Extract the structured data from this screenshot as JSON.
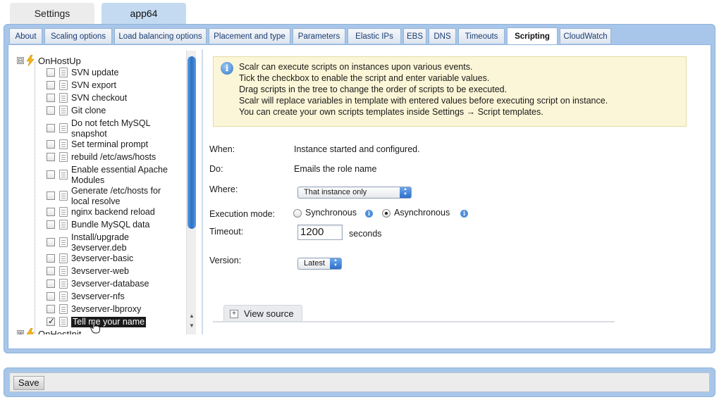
{
  "top_tabs": [
    {
      "label": "Settings",
      "active": false
    },
    {
      "label": "app64",
      "active": true
    }
  ],
  "sub_tabs": [
    {
      "label": "About"
    },
    {
      "label": "Scaling options"
    },
    {
      "label": "Load balancing options"
    },
    {
      "label": "Placement and type"
    },
    {
      "label": "Parameters"
    },
    {
      "label": "Elastic IPs"
    },
    {
      "label": "EBS"
    },
    {
      "label": "DNS"
    },
    {
      "label": "Timeouts"
    },
    {
      "label": "Scripting",
      "active": true
    },
    {
      "label": "CloudWatch"
    }
  ],
  "tree": {
    "groups": [
      {
        "label": "OnHostUp",
        "expanded": true,
        "expander": "⊟"
      },
      {
        "label": "OnHostInit",
        "expanded": false,
        "expander": "⊞"
      }
    ],
    "scripts": [
      {
        "label": "SVN update",
        "checked": false
      },
      {
        "label": "SVN export",
        "checked": false
      },
      {
        "label": "SVN checkout",
        "checked": false
      },
      {
        "label": "Git clone",
        "checked": false
      },
      {
        "label": "Do not fetch MySQL snapshot",
        "checked": false
      },
      {
        "label": "Set terminal prompt",
        "checked": false
      },
      {
        "label": "rebuild /etc/aws/hosts",
        "checked": false
      },
      {
        "label": "Enable essential Apache Modules",
        "checked": false
      },
      {
        "label": "Generate /etc/hosts for local resolve",
        "checked": false
      },
      {
        "label": "nginx backend reload",
        "checked": false
      },
      {
        "label": "Bundle MySQL data",
        "checked": false
      },
      {
        "label": "Install/upgrade 3evserver.deb",
        "checked": false
      },
      {
        "label": "3evserver-basic",
        "checked": false
      },
      {
        "label": "3evserver-web",
        "checked": false
      },
      {
        "label": "3evserver-database",
        "checked": false
      },
      {
        "label": "3evserver-nfs",
        "checked": false
      },
      {
        "label": "3evserver-lbproxy",
        "checked": false
      },
      {
        "label": "Tell me your name",
        "checked": true,
        "selected": true
      }
    ]
  },
  "info": {
    "lines": [
      "Scalr can execute scripts on instances upon various events.",
      "Tick the checkbox to enable the script and enter variable values.",
      "Drag scripts in the tree to change the order of scripts to be executed.",
      "Scalr will replace variables in template with entered values before executing script on instance.",
      "You can create your own scripts templates inside Settings → Script templates."
    ]
  },
  "form": {
    "when_label": "When:",
    "when_value": "Instance started and configured.",
    "do_label": "Do:",
    "do_value": "Emails the role name",
    "where_label": "Where:",
    "where_value": "That instance only",
    "execution_label": "Execution mode:",
    "sync_label": "Synchronous",
    "async_label": "Asynchronous",
    "execution_mode": "Asynchronous",
    "timeout_label": "Timeout:",
    "timeout_value": "1200",
    "timeout_unit": "seconds",
    "version_label": "Version:",
    "version_value": "Latest",
    "view_source_label": "View source"
  },
  "footer": {
    "save_label": "Save"
  },
  "colors": {
    "frame": "#a7c6e9",
    "info_bg": "#fbf6d7",
    "accent": "#2f6fc9"
  }
}
